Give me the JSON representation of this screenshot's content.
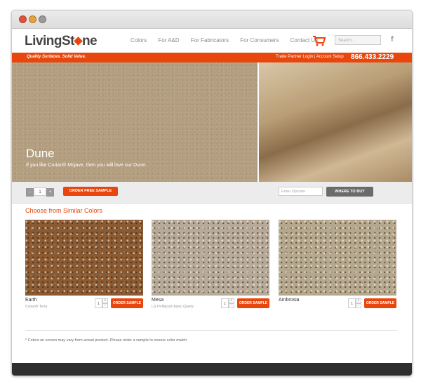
{
  "brand": {
    "name_prefix": "LivingSt",
    "name_suffix": "ne",
    "accent": "#e8460c"
  },
  "nav": [
    "Colors",
    "For A&D",
    "For Fabricators",
    "For Consumers",
    "Contact Us"
  ],
  "search": {
    "placeholder": "Search..."
  },
  "icons": {
    "cart": "cart-icon",
    "facebook": "facebook-icon"
  },
  "banner": {
    "tagline": "Quality Surfaces. Solid Value.",
    "trade_login": "Trade Partner Login",
    "separator": "|",
    "account_setup": "Account Setup",
    "phone": "866.433.2229"
  },
  "hero": {
    "title": "Dune",
    "subtitle": "If you like Corian® Mojave, then you will love our Dune."
  },
  "order_bar": {
    "minus": "–",
    "qty": "1",
    "plus": "+",
    "order_label": "ORDER FREE SAMPLE",
    "zip_placeholder": "Enter Zipcode",
    "where_label": "WHERE TO BUY"
  },
  "similar": {
    "title": "Choose from Similar Colors",
    "items": [
      {
        "name": "Earth",
        "sub": "Corian® Terra",
        "qty": "1",
        "button": "ORDER SAMPLE",
        "swatch": "#8a5a32"
      },
      {
        "name": "Mesa",
        "sub": "LG Hi-Macs® Aztec Quartz",
        "qty": "1",
        "button": "ORDER SAMPLE",
        "swatch": "#b6ab9a"
      },
      {
        "name": "Ambrosia",
        "sub": "",
        "qty": "1",
        "button": "ORDER SAMPLE",
        "swatch": "#b4a88f"
      }
    ]
  },
  "disclaimer": {
    "star": "*",
    "text": "Colors on screen may vary from actual product. Please order a sample to ensure color match."
  },
  "mini": {
    "plus": "+",
    "minus": "–"
  }
}
